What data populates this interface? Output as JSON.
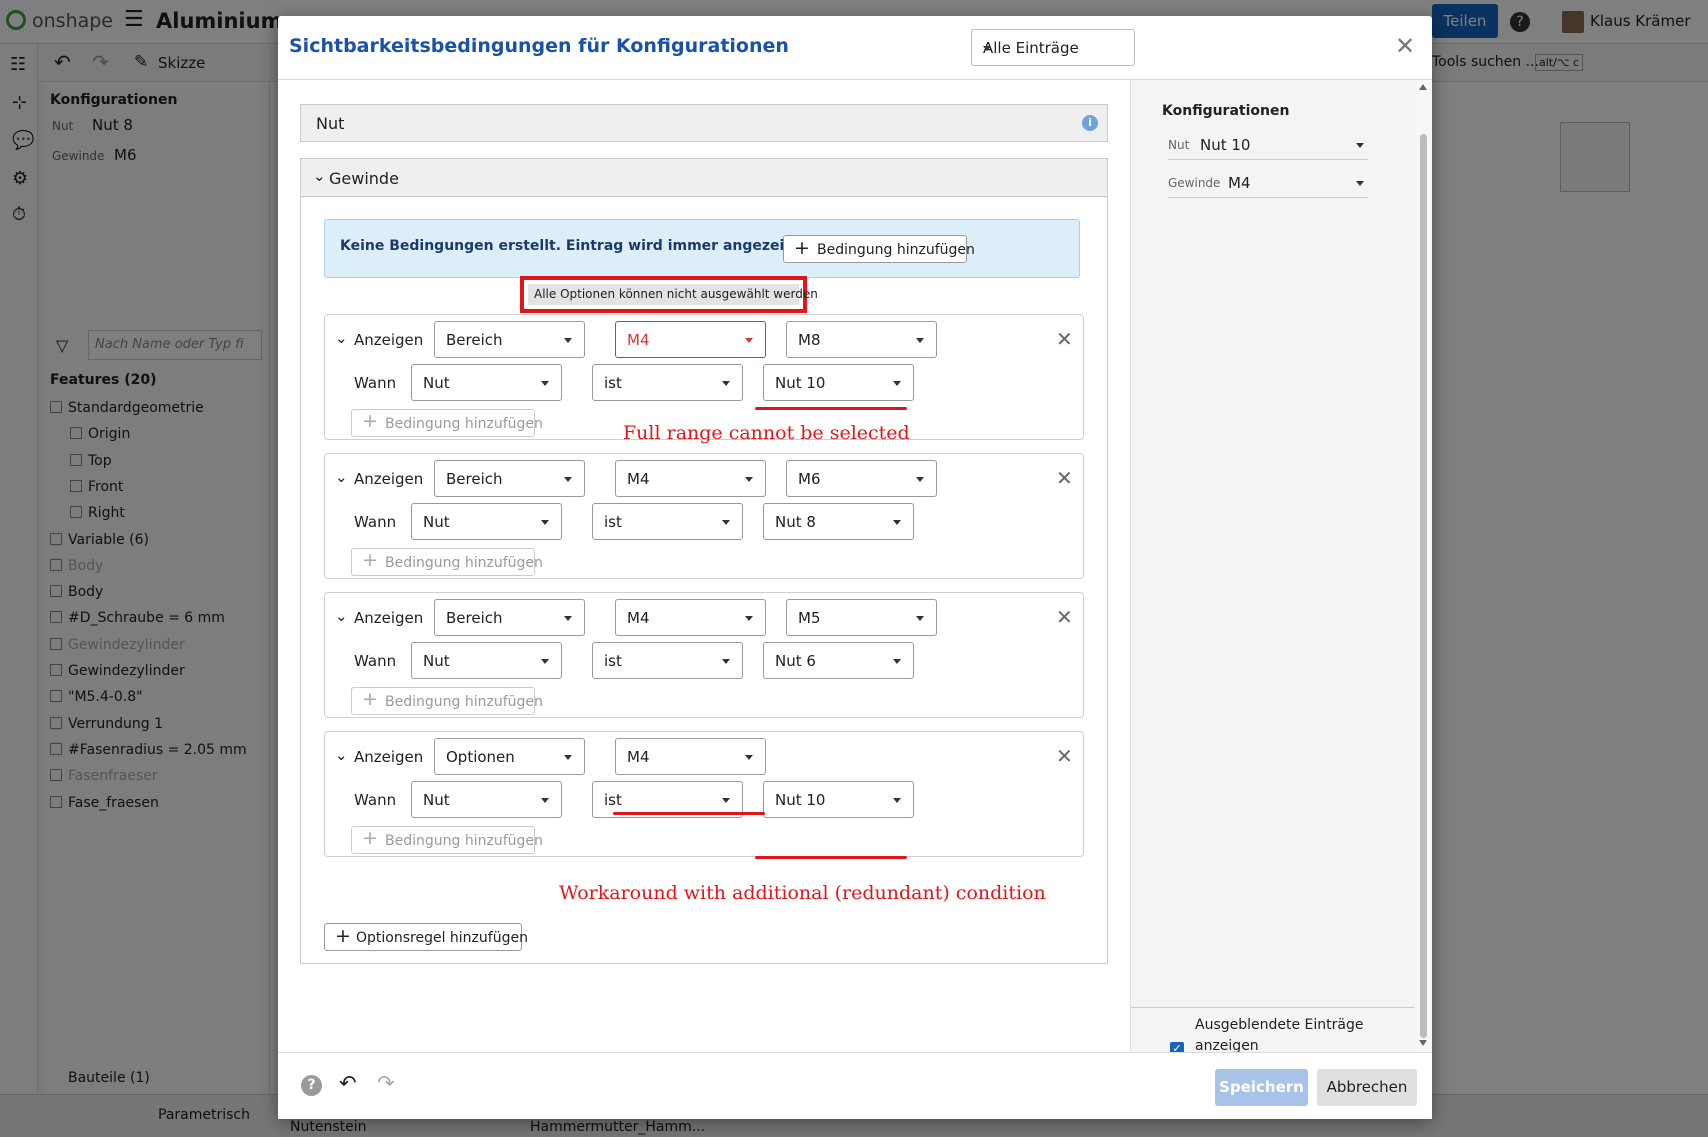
{
  "app": {
    "logo": "onshape",
    "doc_title": "Aluminium",
    "share_label": "Teilen",
    "user_name": "Klaus Krämer",
    "sketch_label": "Skizze",
    "tools_search": "Tools suchen ...",
    "tools_shortcut": "alt/⌥ c",
    "left_panel": {
      "title": "Konfigurationen",
      "config_rows": [
        {
          "label": "Nut",
          "value": "Nut 8"
        },
        {
          "label": "Gewinde",
          "value": "M6"
        }
      ],
      "filter_placeholder": "Nach Name oder Typ fi",
      "features_title": "Features (20)",
      "tree": [
        {
          "label": "Standardgeometrie",
          "indent": 0,
          "muted": false
        },
        {
          "label": "Origin",
          "indent": 1,
          "muted": false
        },
        {
          "label": "Top",
          "indent": 1,
          "muted": false
        },
        {
          "label": "Front",
          "indent": 1,
          "muted": false
        },
        {
          "label": "Right",
          "indent": 1,
          "muted": false
        },
        {
          "label": "Variable (6)",
          "indent": 0,
          "muted": false
        },
        {
          "label": "Body",
          "indent": 0,
          "muted": true
        },
        {
          "label": "Body",
          "indent": 0,
          "muted": false
        },
        {
          "label": "#D_Schraube = 6 mm",
          "indent": 0,
          "muted": false
        },
        {
          "label": "Gewindezylinder",
          "indent": 0,
          "muted": true
        },
        {
          "label": "Gewindezylinder",
          "indent": 0,
          "muted": false
        },
        {
          "label": "\"M5.4-0.8\"",
          "indent": 0,
          "muted": false
        },
        {
          "label": "Verrundung 1",
          "indent": 0,
          "muted": false
        },
        {
          "label": "#Fasenradius = 2.05 mm",
          "indent": 0,
          "muted": false
        },
        {
          "label": "Fasenfraeser",
          "indent": 0,
          "muted": true
        },
        {
          "label": "Fase_fraesen",
          "indent": 0,
          "muted": false
        }
      ],
      "parts_title": "Bauteile (1)"
    },
    "bottom_tabs": [
      "Parametrisch",
      "Nutenstein",
      "Hammermutter_Hamm..."
    ]
  },
  "dialog": {
    "title": "Sichtbarkeitsbedingungen für Konfigurationen",
    "filter_value": "Alle Einträge",
    "section_nut": "Nut",
    "section_gewinde": "Gewinde",
    "info_text": "Keine Bedingungen erstellt. Eintrag wird immer angezeigt.",
    "add_condition_label": "Bedingung hinzufügen",
    "tooltip": "Alle Optionen können nicht ausgewählt werden",
    "rules": [
      {
        "show_label": "Anzeigen",
        "type": "Bereich",
        "from": "M4",
        "to": "M8",
        "when_label": "Wann",
        "param": "Nut",
        "op": "ist",
        "value": "Nut 10",
        "add_label": "Bedingung hinzufügen",
        "error": true
      },
      {
        "show_label": "Anzeigen",
        "type": "Bereich",
        "from": "M4",
        "to": "M6",
        "when_label": "Wann",
        "param": "Nut",
        "op": "ist",
        "value": "Nut 8",
        "add_label": "Bedingung hinzufügen",
        "error": false
      },
      {
        "show_label": "Anzeigen",
        "type": "Bereich",
        "from": "M4",
        "to": "M5",
        "when_label": "Wann",
        "param": "Nut",
        "op": "ist",
        "value": "Nut 6",
        "add_label": "Bedingung hinzufügen",
        "error": false
      },
      {
        "show_label": "Anzeigen",
        "type": "Optionen",
        "from": "M4",
        "to": null,
        "when_label": "Wann",
        "param": "Nut",
        "op": "ist",
        "value": "Nut 10",
        "add_label": "Bedingung hinzufügen",
        "error": false
      }
    ],
    "annotation_1": "Full range cannot be selected",
    "annotation_2": "Workaround with additional (redundant) condition",
    "add_option_rule_label": "Optionsregel hinzufügen",
    "right_pane": {
      "title": "Konfigurationen",
      "rows": [
        {
          "label": "Nut",
          "value": "Nut 10"
        },
        {
          "label": "Gewinde",
          "value": "M4"
        }
      ],
      "checkbox_label_1": "Ausgeblendete Einträge",
      "checkbox_label_2": "anzeigen",
      "checkbox_checked": true
    },
    "save_label": "Speichern",
    "cancel_label": "Abbrechen"
  },
  "colors": {
    "brand_blue": "#1a52a8",
    "annotation_red": "#e0161b",
    "info_bg": "#dceef8",
    "save_disabled": "#a9c3e8"
  }
}
